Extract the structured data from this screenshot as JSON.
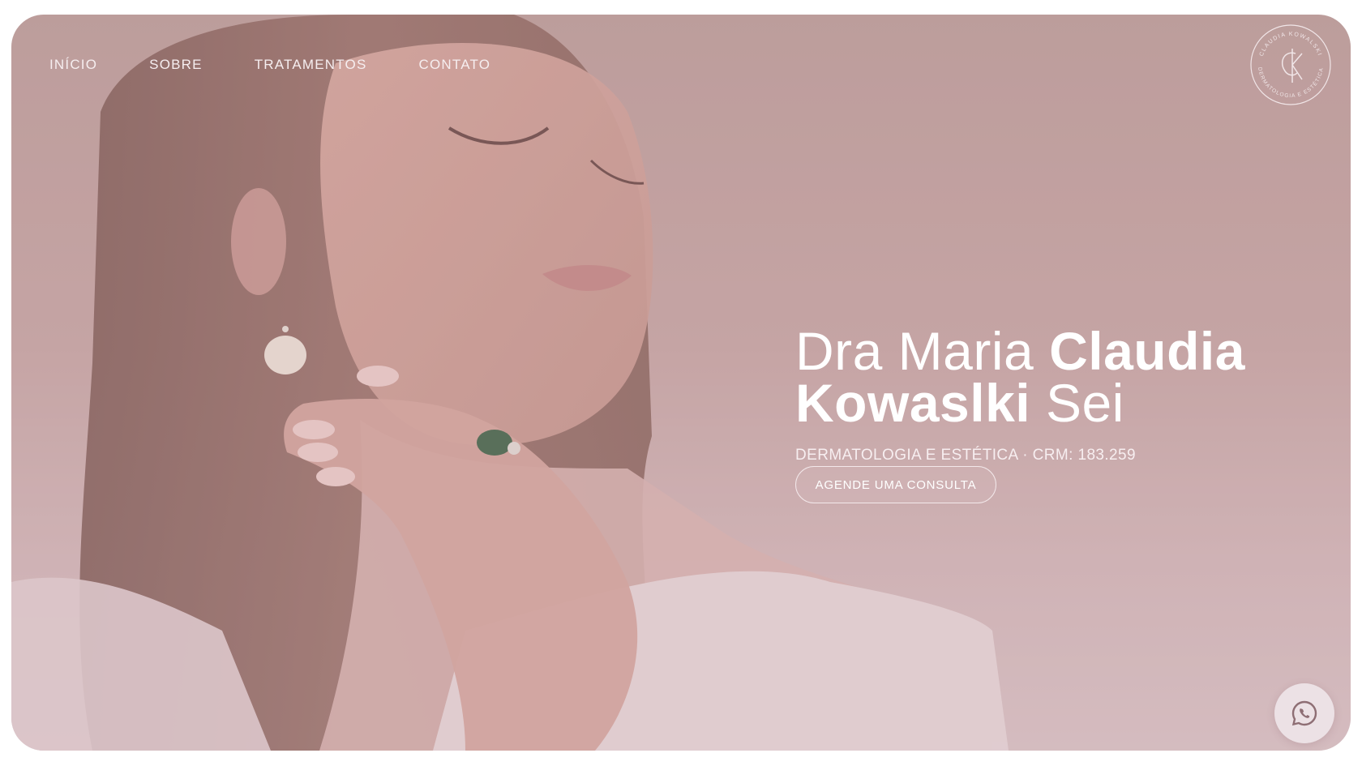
{
  "nav": {
    "items": [
      {
        "label": "INÍCIO"
      },
      {
        "label": "SOBRE"
      },
      {
        "label": "TRATAMENTOS"
      },
      {
        "label": "CONTATO"
      }
    ]
  },
  "logo": {
    "ring_text_top": "CLAUDIA KOWALSKI",
    "ring_text_bottom": "DERMATOLOGIA E ESTÉTICA",
    "monogram": "CK"
  },
  "hero": {
    "title_line1_light": "Dra Maria ",
    "title_line1_bold": "Claudia",
    "title_line2_bold": "Kowaslki",
    "title_line2_light": " Sei",
    "subtitle": "DERMATOLOGIA E ESTÉTICA · CRM: 183.259",
    "cta_label": "AGENDE UMA CONSULTA"
  },
  "floating": {
    "whatsapp_icon": "whatsapp-icon"
  },
  "colors": {
    "overlay_top": "#b89a98",
    "overlay_bottom": "#d9c5ca",
    "text": "#ffffff"
  }
}
